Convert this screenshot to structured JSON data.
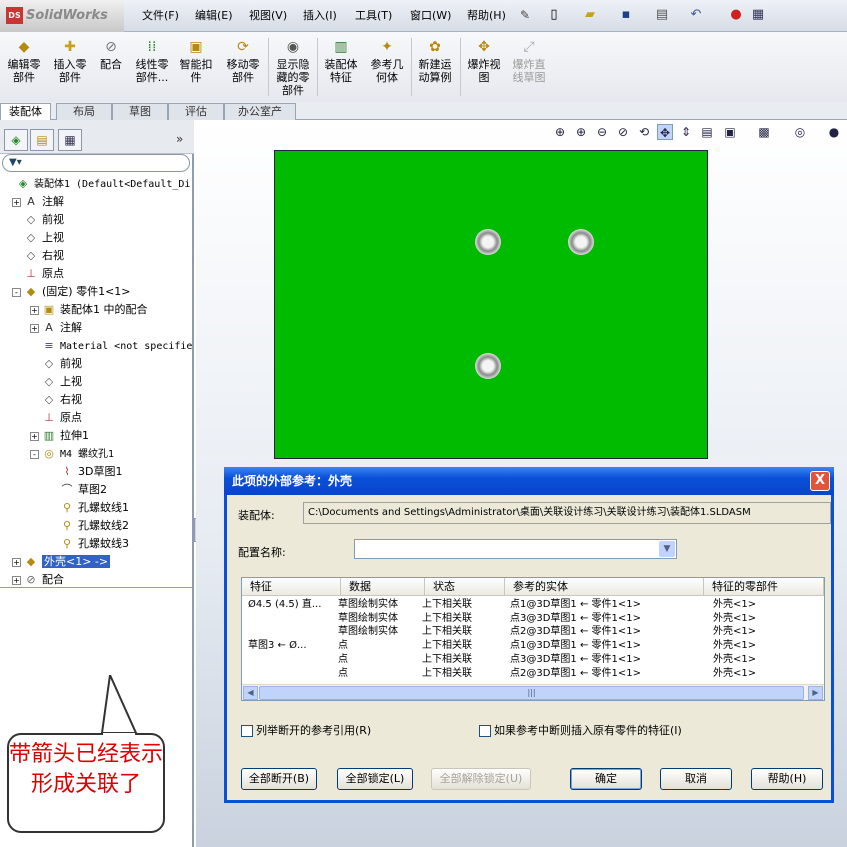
{
  "app": {
    "logo": "SolidWorks",
    "logo_badge": "DS"
  },
  "menu": [
    "文件(F)",
    "编辑(E)",
    "视图(V)",
    "插入(I)",
    "工具(T)",
    "窗口(W)",
    "帮助(H)"
  ],
  "toolbar": [
    {
      "label": "编辑零\n部件",
      "icon": "edit-component-icon"
    },
    {
      "label": "插入零\n部件",
      "icon": "insert-component-icon"
    },
    {
      "label": "配合",
      "icon": "mate-icon"
    },
    {
      "label": "线性零\n部件...",
      "icon": "linear-pattern-icon"
    },
    {
      "label": "智能扣\n件",
      "icon": "smart-fasteners-icon"
    },
    {
      "label": "移动零\n部件",
      "icon": "move-component-icon"
    },
    {
      "label": "显示隐\n藏的零\n部件",
      "icon": "show-hidden-icon"
    },
    {
      "label": "装配体\n特征",
      "icon": "assembly-feature-icon"
    },
    {
      "label": "参考几\n何体",
      "icon": "reference-geometry-icon"
    },
    {
      "label": "新建运\n动算例",
      "icon": "motion-study-icon"
    },
    {
      "label": "爆炸视\n图",
      "icon": "exploded-view-icon"
    },
    {
      "label": "爆炸直\n线草图",
      "icon": "explode-line-icon"
    }
  ],
  "tabs": [
    "装配体",
    "布局",
    "草图",
    "评估",
    "办公室产品"
  ],
  "tree": [
    {
      "label": "装配体1  (Default<Default_Di",
      "icon": "assembly-icon",
      "expander": "",
      "mono": true
    },
    {
      "label": "注解",
      "icon": "annotation-icon",
      "expander": "+"
    },
    {
      "label": "前视",
      "icon": "plane-icon",
      "expander": ""
    },
    {
      "label": "上视",
      "icon": "plane-icon",
      "expander": ""
    },
    {
      "label": "右视",
      "icon": "plane-icon",
      "expander": ""
    },
    {
      "label": "原点",
      "icon": "origin-icon",
      "expander": ""
    },
    {
      "label": "(固定) 零件1<1>",
      "icon": "part-icon",
      "expander": "-"
    },
    {
      "label": "装配体1 中的配合",
      "icon": "mates-folder-icon",
      "expander": "+"
    },
    {
      "label": "注解",
      "icon": "annotation-icon",
      "expander": "+"
    },
    {
      "label": "Material <not specifie",
      "icon": "material-icon",
      "expander": "",
      "mono": true
    },
    {
      "label": "前视",
      "icon": "plane-icon",
      "expander": ""
    },
    {
      "label": "上视",
      "icon": "plane-icon",
      "expander": ""
    },
    {
      "label": "右视",
      "icon": "plane-icon",
      "expander": ""
    },
    {
      "label": "原点",
      "icon": "origin-icon",
      "expander": ""
    },
    {
      "label": "拉伸1",
      "icon": "extrude-icon",
      "expander": "+"
    },
    {
      "label": "M4 螺纹孔1",
      "icon": "hole-wizard-icon",
      "expander": "-",
      "mono": true
    },
    {
      "label": "3D草图1",
      "icon": "sketch3d-icon",
      "expander": ""
    },
    {
      "label": "草图2",
      "icon": "sketch-icon",
      "expander": ""
    },
    {
      "label": "孔螺蚊线1",
      "icon": "thread-icon",
      "expander": ""
    },
    {
      "label": "孔螺蚊线2",
      "icon": "thread-icon",
      "expander": ""
    },
    {
      "label": "孔螺蚊线3",
      "icon": "thread-icon",
      "expander": ""
    },
    {
      "label": "外壳<1> ->",
      "icon": "part-icon",
      "expander": "+",
      "selected": true
    },
    {
      "label": "配合",
      "icon": "mates-icon",
      "expander": "+"
    }
  ],
  "callout": "带箭头已经表示形成关联了",
  "dialog": {
    "title": "此项的外部参考：外壳",
    "close": "X",
    "assembly_label": "装配体:",
    "assembly_path": "C:\\Documents and Settings\\Administrator\\桌面\\关联设计练习\\关联设计练习\\装配体1.SLDASM",
    "config_label": "配置名称:",
    "config_value": "",
    "columns": [
      "特征",
      "数据",
      "状态",
      "参考的实体",
      "特征的零部件"
    ],
    "rows": [
      [
        "Ø4.5 (4.5) 直...",
        "草图绘制实体",
        "上下相关联",
        "点1@3D草图1 ← 零件1<1>",
        "外壳<1>"
      ],
      [
        "",
        "草图绘制实体",
        "上下相关联",
        "点3@3D草图1 ← 零件1<1>",
        "外壳<1>"
      ],
      [
        "",
        "草图绘制实体",
        "上下相关联",
        "点2@3D草图1 ← 零件1<1>",
        "外壳<1>"
      ],
      [
        "草图3 ← Ø...",
        "点",
        "上下相关联",
        "点1@3D草图1 ← 零件1<1>",
        "外壳<1>"
      ],
      [
        "",
        "点",
        "上下相关联",
        "点3@3D草图1 ← 零件1<1>",
        "外壳<1>"
      ],
      [
        "",
        "点",
        "上下相关联",
        "点2@3D草图1 ← 零件1<1>",
        "外壳<1>"
      ]
    ],
    "check_broken": "列举断开的参考引用(R)",
    "check_insert": "如果参考中断则插入原有零件的特征(I)",
    "btn_break_all": "全部断开(B)",
    "btn_lock_all": "全部锁定(L)",
    "btn_unlock_all": "全部解除锁定(U)",
    "btn_ok": "确定",
    "btn_cancel": "取消",
    "btn_help": "帮助(H)"
  }
}
